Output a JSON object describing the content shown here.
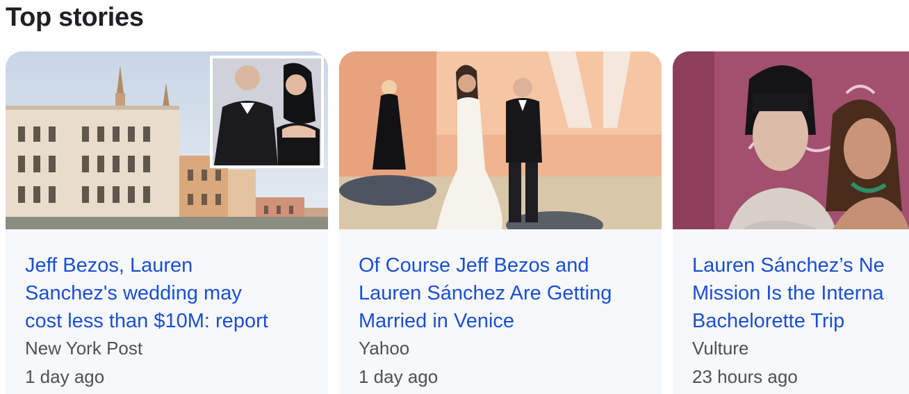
{
  "section": {
    "title": "Top stories"
  },
  "stories": [
    {
      "headline": "Jeff Bezos, Lauren\nSanchez's wedding may\ncost less than $10M: report",
      "source": "New York Post",
      "age": "1 day ago",
      "image": "venice-palazzo-with-couple-inset-photo"
    },
    {
      "headline": "Of Course Jeff Bezos and\nLauren Sánchez Are Getting\nMarried in Venice",
      "source": "Yahoo",
      "age": "1 day ago",
      "image": "couple-walking-red-carpet-photo"
    },
    {
      "headline": "Lauren Sánchez’s Ne\nMission Is the Interna\nBachelorette Trip",
      "source": "Vulture",
      "age": "23 hours ago",
      "image": "two-women-event-photo"
    }
  ],
  "colors": {
    "link": "#1a4fd0",
    "meta": "#4d5156",
    "card_bg": "#f7f8fa"
  }
}
